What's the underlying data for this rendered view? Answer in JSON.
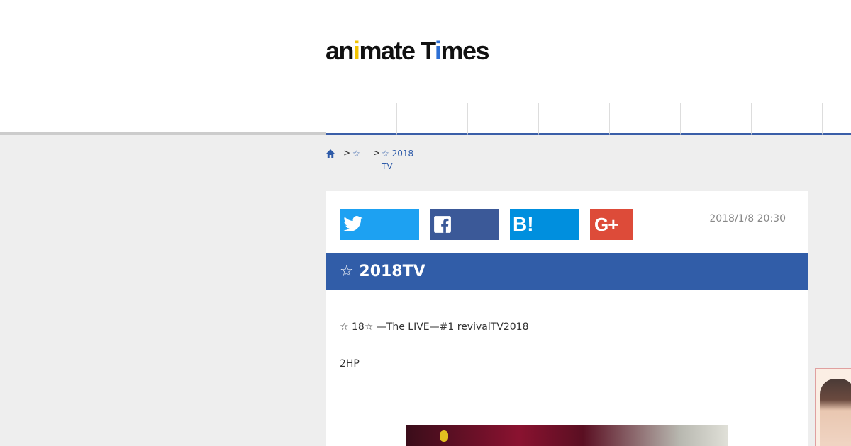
{
  "header": {
    "logo": {
      "part1": "an",
      "part2": "i",
      "part3": "mate ",
      "part4": "T",
      "part5": "i",
      "part6": "mes"
    }
  },
  "nav": {
    "tab_count": 8
  },
  "breadcrumb": {
    "home_icon": "home-icon",
    "separator": ">",
    "crumb1": "☆",
    "crumb2_line1": "☆ 2018",
    "crumb2_line2": "TV"
  },
  "share": {
    "twitter_icon": "twitter-icon",
    "facebook_icon": "facebook-icon",
    "hatena_label": "B!",
    "google_label": "G+"
  },
  "article": {
    "date": "2018/1/8 20:30",
    "title": "☆ 2018TV",
    "paragraph1": "☆ 18☆  —The LIVE—#1 revivalTV2018",
    "paragraph2": "2HP"
  },
  "colors": {
    "accent": "#315da8",
    "twitter": "#1da1f2",
    "facebook": "#3b5998",
    "hatena": "#008fde",
    "google": "#dd4b39",
    "logo_yellow": "#f2c300",
    "logo_blue": "#2d6fd4"
  }
}
